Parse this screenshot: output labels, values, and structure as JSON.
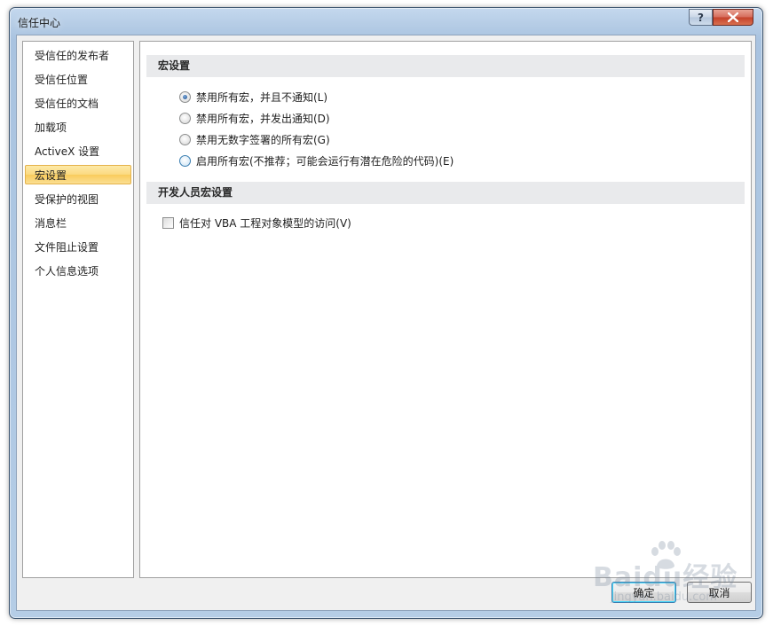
{
  "window": {
    "title": "信任中心",
    "help_label": "?"
  },
  "nav": {
    "items": [
      {
        "label": "受信任的发布者",
        "selected": false
      },
      {
        "label": "受信任位置",
        "selected": false
      },
      {
        "label": "受信任的文档",
        "selected": false
      },
      {
        "label": "加载项",
        "selected": false
      },
      {
        "label": "ActiveX 设置",
        "selected": false
      },
      {
        "label": "宏设置",
        "selected": true
      },
      {
        "label": "受保护的视图",
        "selected": false
      },
      {
        "label": "消息栏",
        "selected": false
      },
      {
        "label": "文件阻止设置",
        "selected": false
      },
      {
        "label": "个人信息选项",
        "selected": false
      }
    ]
  },
  "macro_settings": {
    "header": "宏设置",
    "options": [
      {
        "label": "禁用所有宏，并且不通知(L)",
        "checked": true
      },
      {
        "label": "禁用所有宏，并发出通知(D)",
        "checked": false
      },
      {
        "label": "禁用无数字签署的所有宏(G)",
        "checked": false
      },
      {
        "label": "启用所有宏(不推荐；可能会运行有潜在危险的代码)(E)",
        "checked": false
      }
    ]
  },
  "developer_settings": {
    "header": "开发人员宏设置",
    "trust_vba_label": "信任对 VBA 工程对象模型的访问(V)",
    "trust_vba_checked": false
  },
  "footer": {
    "ok_label": "确定",
    "cancel_label": "取消"
  },
  "watermark": {
    "brand": "Baidu经验",
    "url": "jingyan.baidu.com"
  },
  "colors": {
    "selected_nav": "#fbd980",
    "section_header_bg": "#e9eaec",
    "close_button": "#c4402a",
    "frame": "#b6cde6"
  }
}
